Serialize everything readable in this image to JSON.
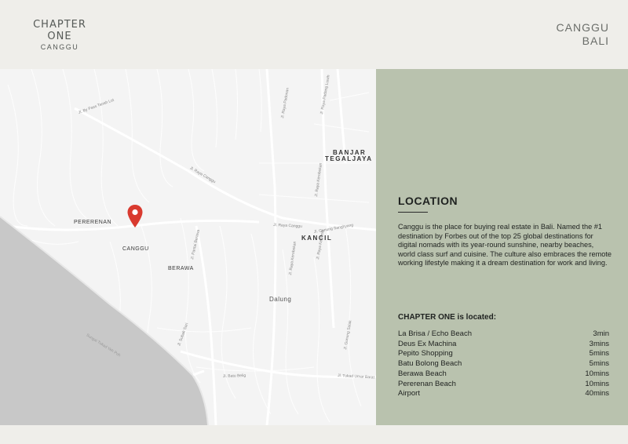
{
  "header": {
    "brand_title": "CHAPTER ONE",
    "brand_subtitle": "CANGGU",
    "place_line1": "CANGGU",
    "place_line2": "BALI"
  },
  "map": {
    "labels": {
      "pererenan": "PERERENAN",
      "canggu": "CANGGU",
      "berawa": "BERAWA",
      "kancil": "KANCIL",
      "banjar": "BANJAR",
      "tegaljaya": "TEGALJAYA",
      "dalung": "Dalung",
      "sungai": "Sungai Tukad Yeh Poh"
    },
    "roads": {
      "bypass": "Jl. By Pass Tanah Lot",
      "raya_canggu": "Jl. Raya Canggu",
      "raya_canggu2": "Jl. Raya Canggu",
      "gunung": "Jl. Gunung Sanghyang",
      "padonan": "Jl. Raya Padonan",
      "padang": "Jl. Raya Padang Luwih",
      "kerobokan": "Jl. Raya Kerobokan",
      "kerobokan2": "Jl. Raya Kerobokan",
      "kesambi": "Jl. Raya Kesambi",
      "pantai_berawa": "Jl. Pantai Berawa",
      "subak_sari": "Jl. Subak Sari",
      "batu_belig": "Jl. Batu Belig",
      "tukad_umar": "Jl. Tukad Umar Barat",
      "gunung_salak": "Jl. Gunung Salak"
    },
    "pin_icon": "map-pin-icon",
    "pin_color": "#d93a2f"
  },
  "panel": {
    "title": "LOCATION",
    "description": "Canggu is the place for buying real estate in Bali. Named the #1 destination by Forbes out of the top 25 global destinations for digital nomads with its year-round sunshine, nearby beaches, world class surf and cuisine. The culture also embraces the remote working lifestyle making it a dream destination for work and living.",
    "located_heading": "CHAPTER ONE is located:",
    "places": [
      {
        "name": "La Brisa / Echo Beach",
        "time": "3min"
      },
      {
        "name": "Deus Ex Machina",
        "time": "3mins"
      },
      {
        "name": "Pepito Shopping",
        "time": "5mins"
      },
      {
        "name": "Batu Bolong Beach",
        "time": "5mins"
      },
      {
        "name": "Berawa Beach",
        "time": "10mins"
      },
      {
        "name": "Pererenan Beach",
        "time": "10mins"
      },
      {
        "name": "Airport",
        "time": "40mins"
      }
    ],
    "bg_color": "#b9c2ae"
  }
}
